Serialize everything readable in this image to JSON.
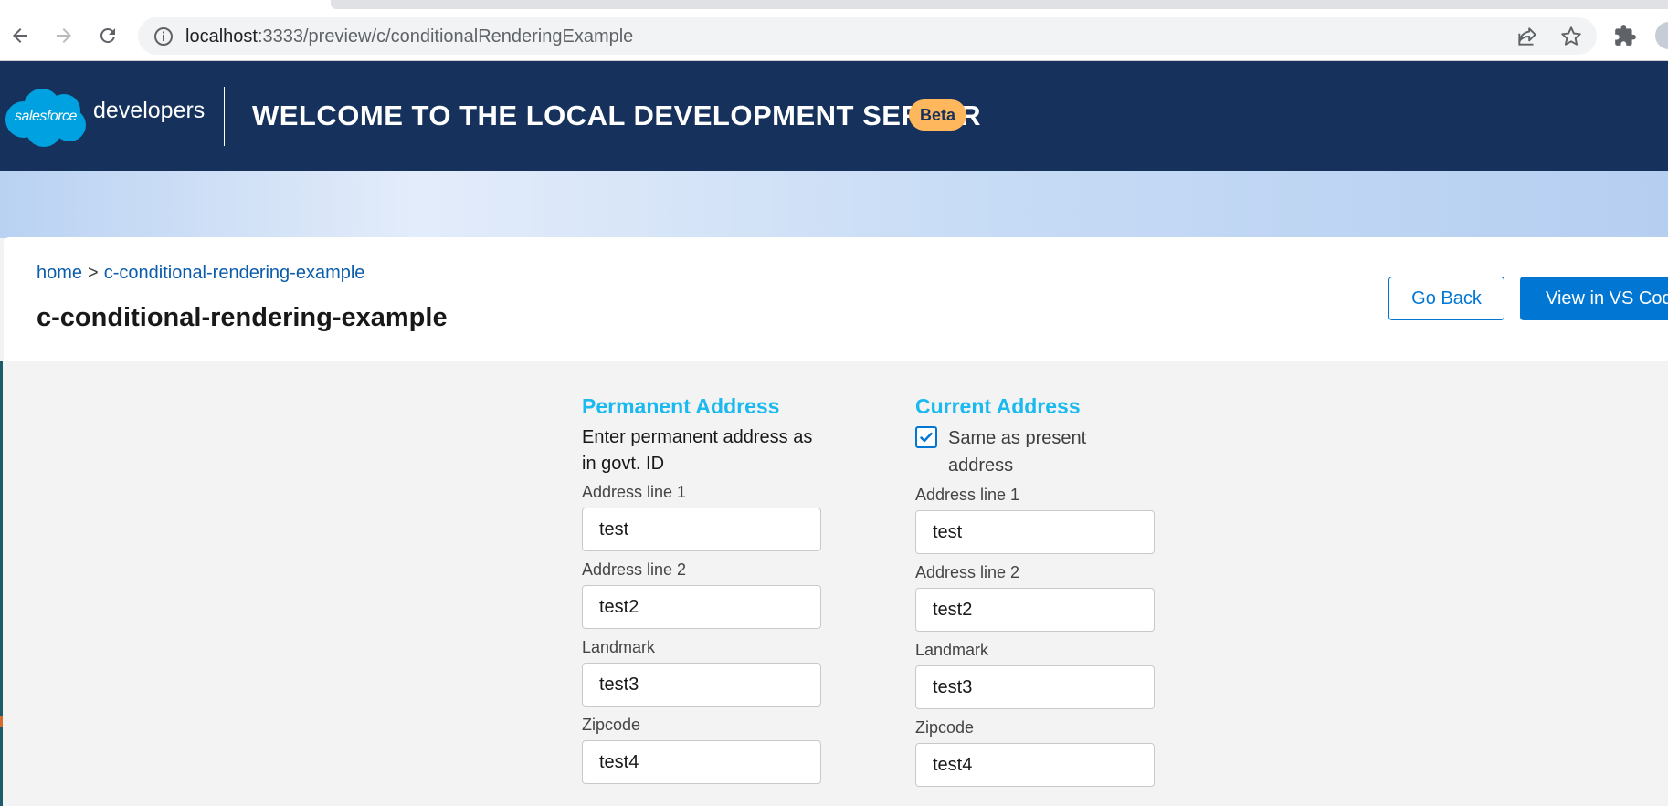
{
  "browser": {
    "url_host": "localhost",
    "url_rest": ":3333/preview/c/conditionalRenderingExample",
    "back_icon": "back-arrow-icon",
    "forward_icon": "forward-arrow-icon",
    "reload_icon": "reload-icon"
  },
  "header": {
    "logo_text": "salesforce",
    "brand_suffix": "developers",
    "title": "Welcome to the Local Development Server",
    "badge": "Beta",
    "colors": {
      "background": "#16325c",
      "badge": "#ffb75d"
    }
  },
  "page": {
    "breadcrumb": {
      "home": "home",
      "separator": ">",
      "current": "c-conditional-rendering-example"
    },
    "title": "c-conditional-rendering-example",
    "go_back_label": "Go Back",
    "vscode_label": "View in VS Code"
  },
  "permanent": {
    "title": "Permanent Address",
    "description": "Enter permanent address as in govt. ID",
    "fields": [
      {
        "label": "Address line 1",
        "value": "test"
      },
      {
        "label": "Address line 2",
        "value": "test2"
      },
      {
        "label": "Landmark",
        "value": "test3"
      },
      {
        "label": "Zipcode",
        "value": "test4"
      }
    ]
  },
  "current": {
    "title": "Current Address",
    "same_as_label": "Same as present address",
    "same_as_checked": true,
    "fields": [
      {
        "label": "Address line 1",
        "value": "test"
      },
      {
        "label": "Address line 2",
        "value": "test2"
      },
      {
        "label": "Landmark",
        "value": "test3"
      },
      {
        "label": "Zipcode",
        "value": "test4"
      }
    ]
  }
}
